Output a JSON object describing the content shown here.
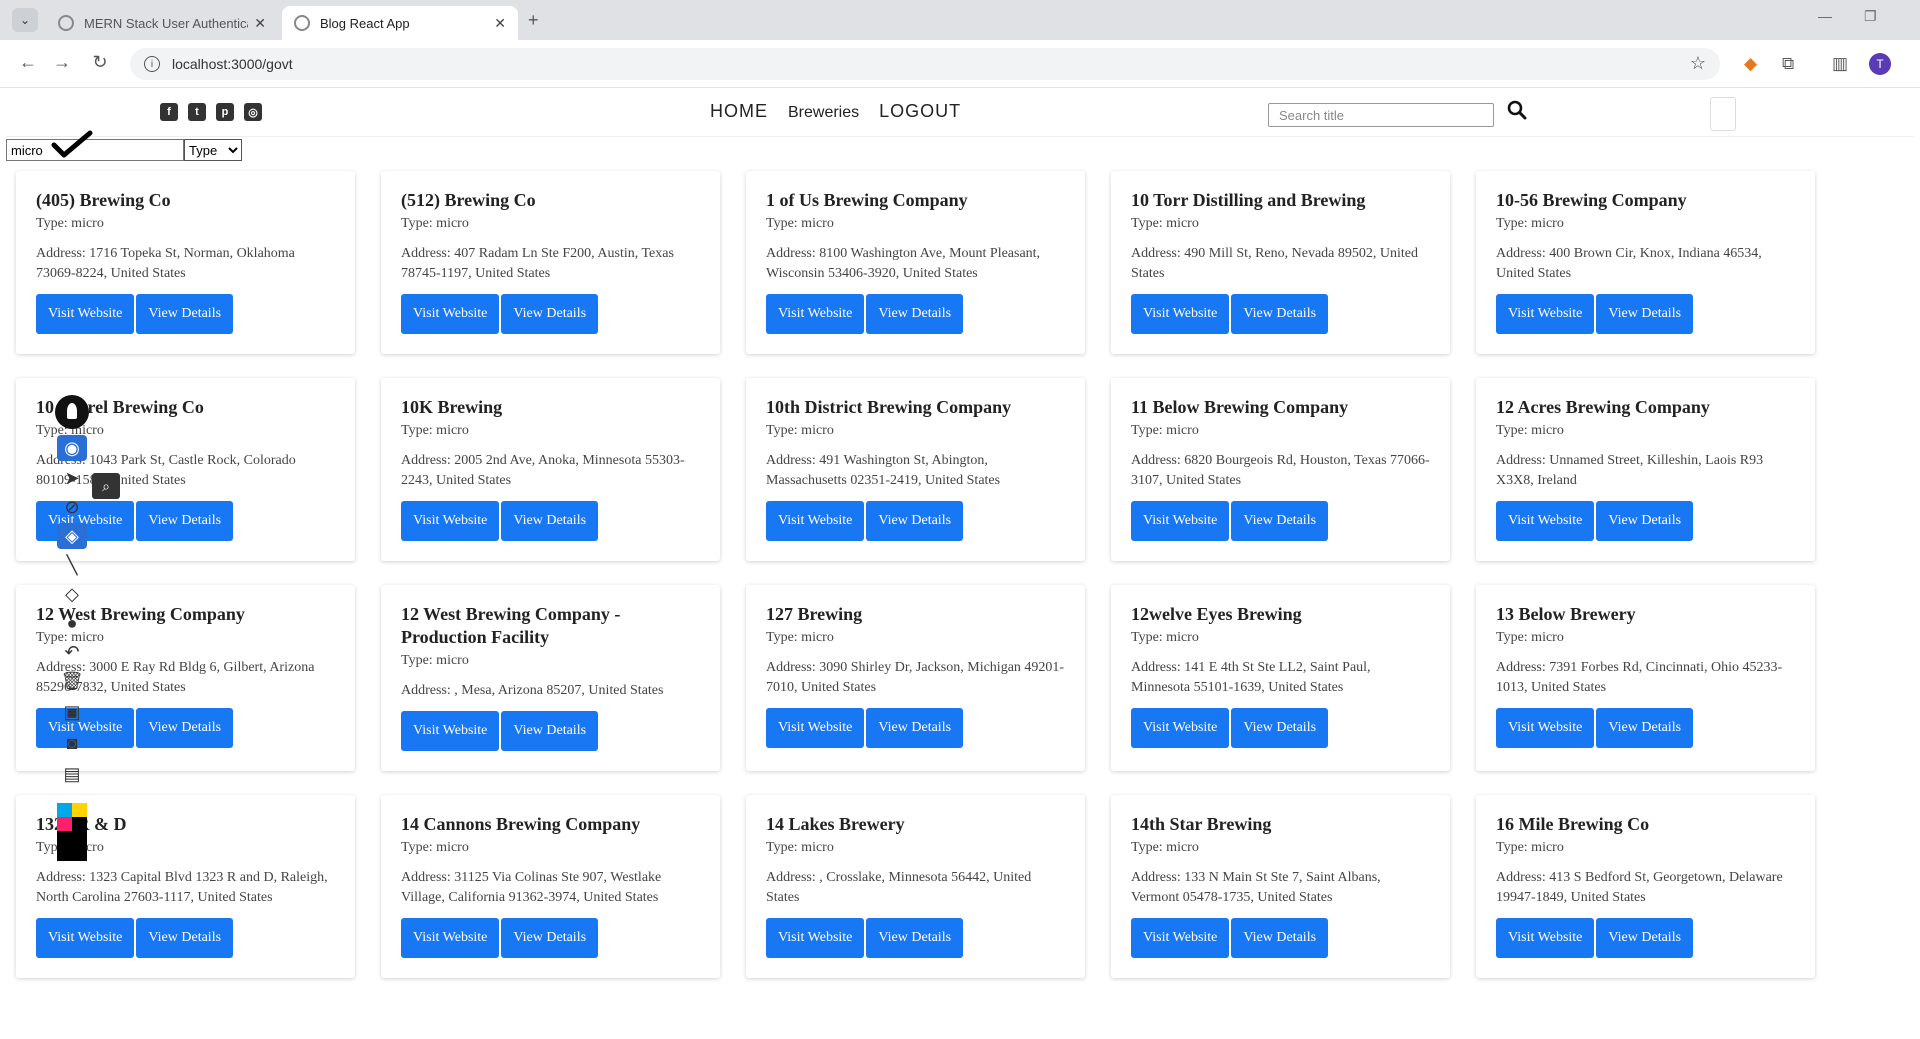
{
  "browser": {
    "tabs": [
      {
        "title": "MERN Stack User Authenticati",
        "active": false
      },
      {
        "title": "Blog React App",
        "active": true
      }
    ],
    "url": "localhost:3000/govt",
    "profile_initial": "T"
  },
  "header": {
    "social_icons": [
      "facebook-icon",
      "twitter-icon",
      "pinterest-icon",
      "instagram-icon"
    ],
    "nav": {
      "home": "HOME",
      "breweries": "Breweries",
      "logout": "LOGOUT"
    },
    "search_placeholder": "Search title"
  },
  "filter": {
    "value": "micro",
    "select_label": "Type"
  },
  "buttons": {
    "visit": "Visit Website",
    "details": "View Details"
  },
  "breweries": [
    {
      "name": "(405) Brewing Co",
      "type": "Type: micro",
      "address": "Address: 1716 Topeka St, Norman, Oklahoma 73069-8224, United States"
    },
    {
      "name": "(512) Brewing Co",
      "type": "Type: micro",
      "address": "Address: 407 Radam Ln Ste F200, Austin, Texas 78745-1197, United States"
    },
    {
      "name": "1 of Us Brewing Company",
      "type": "Type: micro",
      "address": "Address: 8100 Washington Ave, Mount Pleasant, Wisconsin 53406-3920, United States"
    },
    {
      "name": "10 Torr Distilling and Brewing",
      "type": "Type: micro",
      "address": "Address: 490 Mill St, Reno, Nevada 89502, United States"
    },
    {
      "name": "10-56 Brewing Company",
      "type": "Type: micro",
      "address": "Address: 400 Brown Cir, Knox, Indiana 46534, United States"
    },
    {
      "name": "10 Barrel Brewing Co",
      "type": "Type: micro",
      "address": "Address: 1043 Park St, Castle Rock, Colorado 80109-1585, United States"
    },
    {
      "name": "10K Brewing",
      "type": "Type: micro",
      "address": "Address: 2005 2nd Ave, Anoka, Minnesota 55303-2243, United States"
    },
    {
      "name": "10th District Brewing Company",
      "type": "Type: micro",
      "address": "Address: 491 Washington St, Abington, Massachusetts 02351-2419, United States"
    },
    {
      "name": "11 Below Brewing Company",
      "type": "Type: micro",
      "address": "Address: 6820 Bourgeois Rd, Houston, Texas 77066-3107, United States"
    },
    {
      "name": "12 Acres Brewing Company",
      "type": "Type: micro",
      "address": "Address: Unnamed Street, Killeshin, Laois R93 X3X8, Ireland"
    },
    {
      "name": "12 West Brewing Company",
      "type": "Type: micro",
      "address": "Address: 3000 E Ray Rd Bldg 6, Gilbert, Arizona 85296-7832, United States"
    },
    {
      "name": "12 West Brewing Company - Production Facility",
      "type": "Type: micro",
      "address": "Address: , Mesa, Arizona 85207, United States"
    },
    {
      "name": "127 Brewing",
      "type": "Type: micro",
      "address": "Address: 3090 Shirley Dr, Jackson, Michigan 49201-7010, United States"
    },
    {
      "name": "12welve Eyes Brewing",
      "type": "Type: micro",
      "address": "Address: 141 E 4th St Ste LL2, Saint Paul, Minnesota 55101-1639, United States"
    },
    {
      "name": "13 Below Brewery",
      "type": "Type: micro",
      "address": "Address: 7391 Forbes Rd, Cincinnati, Ohio 45233-1013, United States"
    },
    {
      "name": "1323 R & D",
      "type": "Type: micro",
      "address": "Address: 1323 Capital Blvd 1323 R and D, Raleigh, North Carolina 27603-1117, United States"
    },
    {
      "name": "14 Cannons Brewing Company",
      "type": "Type: micro",
      "address": "Address: 31125 Via Colinas Ste 907, Westlake Village, California 91362-3974, United States"
    },
    {
      "name": "14 Lakes Brewery",
      "type": "Type: micro",
      "address": "Address: , Crosslake, Minnesota 56442, United States"
    },
    {
      "name": "14th Star Brewing",
      "type": "Type: micro",
      "address": "Address: 133 N Main St Ste 7, Saint Albans, Vermont 05478-1735, United States"
    },
    {
      "name": "16 Mile Brewing Co",
      "type": "Type: micro",
      "address": "Address: 413 S Bedford St, Georgetown, Delaware 19947-1849, United States"
    }
  ],
  "annotation_toolbar": {
    "tools": [
      "pen-icon",
      "eye-icon",
      "pointer-icon",
      "highlighter-icon",
      "tag-icon",
      "line-icon",
      "eraser-icon",
      "dot-icon",
      "undo-icon",
      "trash-icon",
      "screen-icon",
      "camera-icon",
      "clipboard-icon"
    ],
    "colors": [
      "#00a8e8",
      "#ffd400",
      "#ff1f6b",
      "#000000"
    ]
  }
}
